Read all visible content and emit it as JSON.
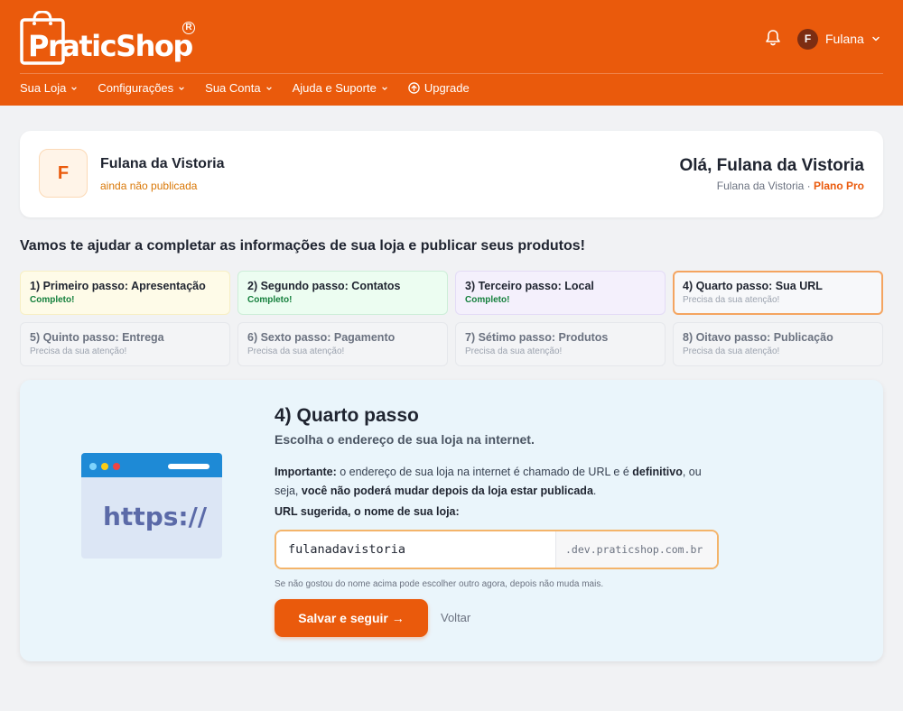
{
  "header": {
    "logo_text": "PraticShop",
    "user_name": "Fulana",
    "user_initial": "F",
    "nav": [
      {
        "label": "Sua Loja"
      },
      {
        "label": "Configurações"
      },
      {
        "label": "Sua Conta"
      },
      {
        "label": "Ajuda e Suporte"
      },
      {
        "label": "Upgrade"
      }
    ]
  },
  "store": {
    "initial": "F",
    "name": "Fulana da Vistoria",
    "status": "ainda não publicada",
    "greeting": "Olá, Fulana da Vistoria",
    "owner": "Fulana da Vistoria ·",
    "plan": "Plano Pro"
  },
  "intro": "Vamos te ajudar a completar as informações de sua loja e publicar seus produtos!",
  "steps": [
    {
      "title": "1) Primeiro passo: Apresentação",
      "status": "Completo!"
    },
    {
      "title": "2) Segundo passo: Contatos",
      "status": "Completo!"
    },
    {
      "title": "3) Terceiro passo: Local",
      "status": "Completo!"
    },
    {
      "title": "4) Quarto passo: Sua URL",
      "status": "Precisa da sua atenção!"
    },
    {
      "title": "5) Quinto passo: Entrega",
      "status": "Precisa da sua atenção!"
    },
    {
      "title": "6) Sexto passo: Pagamento",
      "status": "Precisa da sua atenção!"
    },
    {
      "title": "7) Sétimo passo: Produtos",
      "status": "Precisa da sua atenção!"
    },
    {
      "title": "8) Oitavo passo: Publicação",
      "status": "Precisa da sua atenção!"
    }
  ],
  "panel": {
    "illustration_text": "https://",
    "title": "4) Quarto passo",
    "subtitle": "Escolha o endereço de sua loja na internet.",
    "note_1": "Importante:",
    "note_2": " o endereço de sua loja na internet é chamado de URL e é ",
    "note_3": "definitivo",
    "note_4": ", ou seja, ",
    "note_5": "você não poderá mudar depois da loja estar publicada",
    "note_6": ".",
    "url_label": "URL sugerida, o nome de sua loja:",
    "url_value": "fulanadavistoria",
    "url_suffix": ".dev.praticshop.com.br",
    "hint": "Se não gostou do nome acima pode escolher outro agora, depois não muda mais.",
    "save_label": "Salvar e seguir →",
    "back_label": "Voltar"
  },
  "colors": {
    "brand": "#ea5a0c",
    "complete": "#15803d",
    "active_border": "#f4a460"
  }
}
